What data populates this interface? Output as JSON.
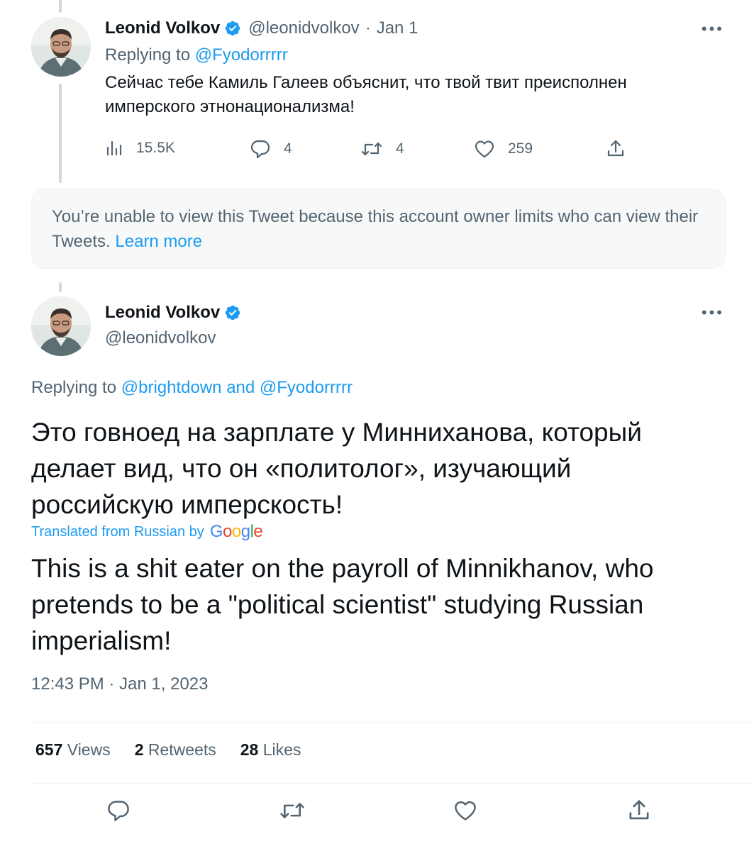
{
  "tweet1": {
    "name": "Leonid Volkov",
    "handle": "@leonidvolkov",
    "separator": "·",
    "date": "Jan 1",
    "replying_prefix": "Replying to",
    "replying_to": "@Fyodorrrrr",
    "text_line1": "Сейчас тебе Камиль Галеев объяснит, что твой твит преисполнен",
    "text_line2": "имперского этнонационализма!",
    "views": "15.5K",
    "replies": "4",
    "retweets": "4",
    "likes": "259"
  },
  "unavailable": {
    "text": "You’re unable to view this Tweet because this account owner limits who can view their Tweets.",
    "link": "Learn more"
  },
  "tweet2": {
    "name": "Leonid Volkov",
    "handle": "@leonidvolkov",
    "replying_prefix": "Replying to",
    "replying_to": "@brightdown and @Fyodorrrrr",
    "text_line1": "Это говноед на зарплате у Минниханова, который",
    "text_line2": "делает вид, что он «политолог», изучающий",
    "text_line3": "российскую имперскость!",
    "translated_label": "Translated from Russian by",
    "google_logo": [
      "G",
      "o",
      "o",
      "g",
      "l",
      "e"
    ],
    "translation_line1": "This is a shit eater on the payroll of Minnikhanov, who",
    "translation_line2": "pretends to be a \"political scientist\" studying Russian",
    "translation_line3": "imperialism!",
    "timestamp": "12:43 PM · Jan 1, 2023",
    "stats": {
      "views_count": "657",
      "views_label": "Views",
      "retweets_count": "2",
      "retweets_label": "Retweets",
      "likes_count": "28",
      "likes_label": "Likes"
    }
  },
  "icons": [
    "verified-badge-icon",
    "more-icon",
    "views-icon",
    "reply-icon",
    "retweet-icon",
    "like-icon",
    "share-icon"
  ],
  "colors": {
    "accent": "#1d9bf0",
    "text": "#0f1419",
    "muted": "#536471",
    "thread_line": "#cfd9de",
    "notice_bg": "#f7f9f9"
  }
}
